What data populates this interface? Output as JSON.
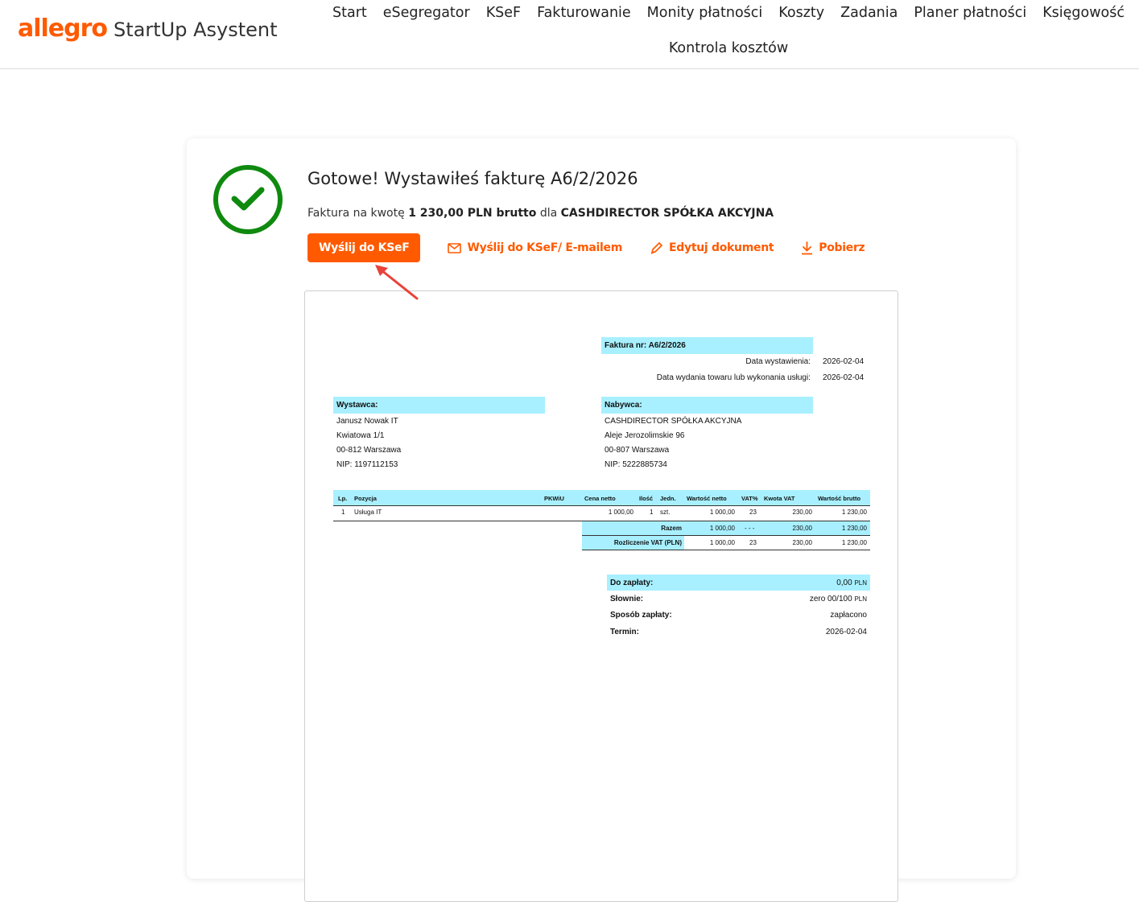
{
  "header": {
    "logo_brand": "allegro",
    "logo_product": "StartUp Asystent",
    "nav": [
      "Start",
      "eSegregator",
      "KSeF",
      "Fakturowanie",
      "Monity płatności",
      "Koszty",
      "Zadania",
      "Planer płatności",
      "Księgowość",
      "Kontrola kosztów"
    ]
  },
  "success": {
    "title": "Gotowe! Wystawiłeś fakturę A6/2/2026",
    "sub_prefix": "Faktura na kwotę ",
    "sub_amount": "1 230,00 PLN brutto",
    "sub_mid": " dla ",
    "sub_client": "CASHDIRECTOR SPÓŁKA AKCYJNA"
  },
  "actions": {
    "send_ksef": "Wyślij do KSeF",
    "send_email": "Wyślij do KSeF/ E-mailem",
    "edit": "Edytuj dokument",
    "download": "Pobierz"
  },
  "invoice": {
    "title": "Faktura nr: A6/2/2026",
    "issue_label": "Data wystawienia:",
    "issue_date": "2026-02-04",
    "delivery_label": "Data wydania towaru lub wykonania usługi:",
    "delivery_date": "2026-02-04",
    "seller_label": "Wystawca:",
    "seller_lines": [
      "Janusz Nowak IT",
      "Kwiatowa 1/1",
      "00-812 Warszawa",
      "NIP: 1197112153"
    ],
    "buyer_label": "Nabywca:",
    "buyer_lines": [
      "CASHDIRECTOR SPÓŁKA AKCYJNA",
      "Aleje Jerozolimskie 96",
      "00-807 Warszawa",
      "NIP: 5222885734"
    ],
    "columns": [
      "Lp.",
      "Pozycja",
      "PKWiU",
      "Cena netto",
      "Ilość",
      "Jedn.",
      "Wartość netto",
      "VAT%",
      "Kwota VAT",
      "Wartość brutto"
    ],
    "row": [
      "1",
      "Usługa IT",
      "",
      "1 000,00",
      "1",
      "szt.",
      "1 000,00",
      "23",
      "230,00",
      "1 230,00"
    ],
    "total_label": "Razem",
    "total": [
      "1 000,00",
      "- - -",
      "230,00",
      "1 230,00"
    ],
    "vat_label": "Rozliczenie VAT (PLN)",
    "vat": [
      "1 000,00",
      "23",
      "230,00",
      "1 230,00"
    ],
    "pay_label": "Do zapłaty:",
    "pay_value": "0,00",
    "pay_currency": "PLN",
    "words_label": "Słownie:",
    "words_value": "zero 00/100",
    "words_currency": "PLN",
    "method_label": "Sposób zapłaty:",
    "method_value": "zapłacono",
    "term_label": "Termin:",
    "term_value": "2026-02-04"
  }
}
